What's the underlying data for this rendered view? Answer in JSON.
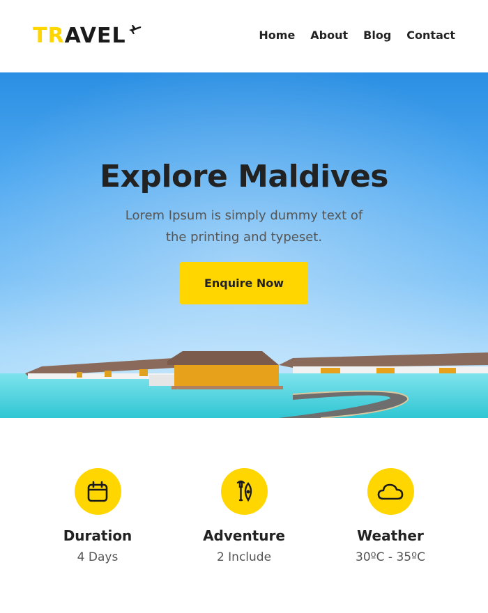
{
  "header": {
    "logo": {
      "part1": "TR",
      "part2": "AVEL"
    },
    "nav": [
      "Home",
      "About",
      "Blog",
      "Contact"
    ]
  },
  "hero": {
    "title": "Explore Maldives",
    "subtitle": "Lorem Ipsum is simply dummy text of the printing and typeset.",
    "cta_label": "Enquire Now"
  },
  "features": [
    {
      "icon": "calendar-icon",
      "title": "Duration",
      "value": "4 Days"
    },
    {
      "icon": "paddle-icon",
      "title": "Adventure",
      "value": "2 Include"
    },
    {
      "icon": "cloud-icon",
      "title": "Weather",
      "value": "30ºC - 35ºC"
    }
  ],
  "colors": {
    "accent": "#ffd600",
    "text": "#222222",
    "muted": "#555555",
    "sky": "#4ea8f0",
    "sea": "#3fd4de"
  }
}
